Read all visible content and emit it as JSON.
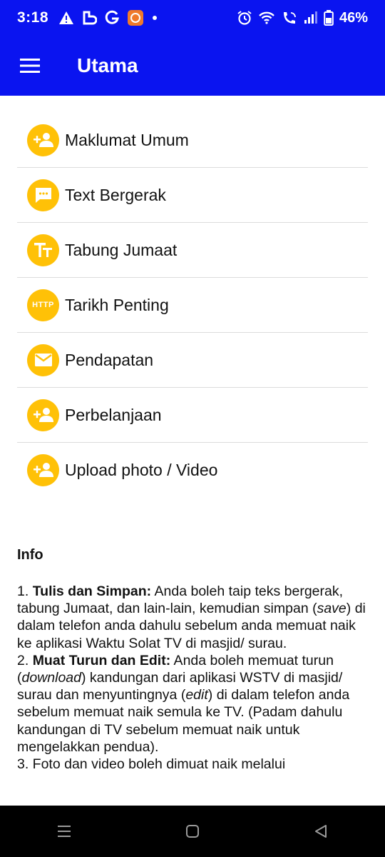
{
  "status_bar": {
    "time": "3:18",
    "battery_percent": "46%",
    "left_icons": [
      "warning-icon",
      "bixby-icon",
      "google-icon",
      "app-notification-icon",
      "dot-icon"
    ],
    "right_icons": [
      "alarm-icon",
      "wifi-icon",
      "wifi-call-icon",
      "signal-icon",
      "battery-icon"
    ]
  },
  "app_bar": {
    "title": "Utama",
    "background": "#0a14f0"
  },
  "menu": {
    "accent": "#ffc107",
    "items": [
      {
        "label": "Maklumat Umum",
        "icon": "add-person-icon"
      },
      {
        "label": "Text Bergerak",
        "icon": "chat-bubble-icon"
      },
      {
        "label": "Tabung Jumaat",
        "icon": "text-format-icon"
      },
      {
        "label": "Tarikh Penting",
        "icon": "http-icon"
      },
      {
        "label": "Pendapatan",
        "icon": "envelope-icon"
      },
      {
        "label": "Perbelanjaan",
        "icon": "add-person-icon"
      },
      {
        "label": "Upload photo / Video",
        "icon": "add-person-icon"
      }
    ],
    "http_icon_text": "HTTP"
  },
  "info": {
    "title": "Info",
    "p1_num": "1. ",
    "p1_bold": "Tulis dan Simpan:",
    "p1_a": " Anda boleh taip teks bergerak, tabung Jumaat, dan lain-lain, kemudian simpan (",
    "p1_italic": "save",
    "p1_b": ") di dalam telefon anda dahulu sebelum anda memuat naik ke aplikasi Waktu Solat TV di masjid/ surau.",
    "p2_num": "2. ",
    "p2_bold": "Muat Turun dan Edit:",
    "p2_a": " Anda boleh memuat turun (",
    "p2_italic1": "download",
    "p2_b": ") kandungan dari aplikasi WSTV di masjid/ surau dan menyuntingnya (",
    "p2_italic2": "edit",
    "p2_c": ") di dalam telefon anda sebelum memuat naik semula ke TV. (Padam dahulu kandungan di TV sebelum memuat naik untuk mengelakkan pendua).",
    "p3": "3. Foto dan video boleh dimuat naik melalui"
  }
}
